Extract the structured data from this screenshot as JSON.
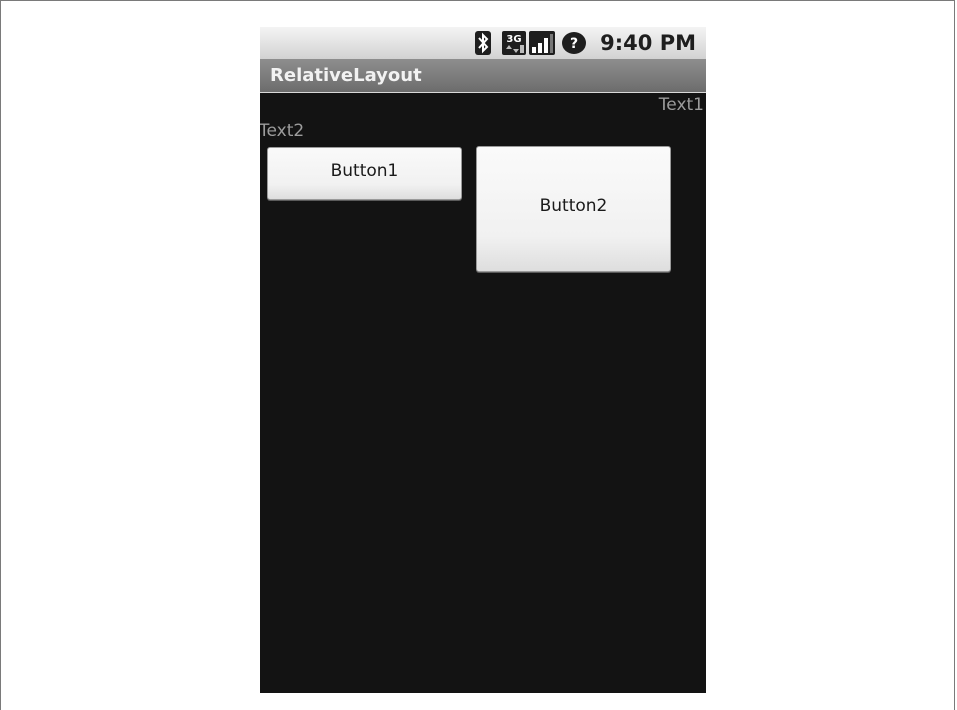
{
  "status_bar": {
    "time": "9:40 PM",
    "icons": [
      "bluetooth-icon",
      "3g-icon",
      "signal-icon",
      "alert-icon"
    ],
    "threeg_label": "3G"
  },
  "app": {
    "title": "RelativeLayout"
  },
  "content": {
    "text1": "Text1",
    "text2": "Text2",
    "button1_label": "Button1",
    "button2_label": "Button2"
  },
  "colors": {
    "screen_background": "#131313",
    "title_bar": "#7c7c7c",
    "label_text": "#9c9c9c",
    "button_face": "#f4f4f4"
  }
}
